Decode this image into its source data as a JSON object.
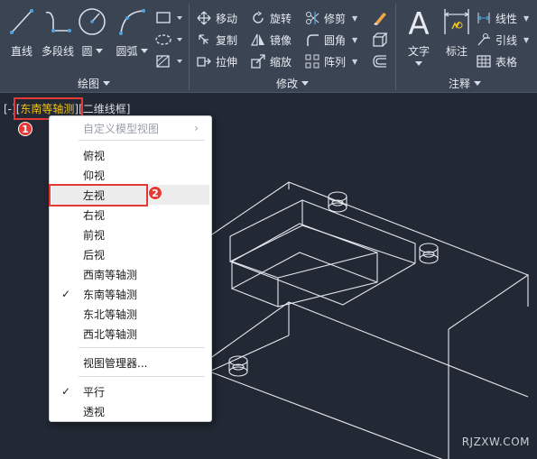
{
  "ribbon": {
    "draw_panel": {
      "title": "绘图",
      "line": "直线",
      "polyline": "多段线",
      "circle": "圆",
      "arc": "圆弧"
    },
    "modify_panel": {
      "title": "修改",
      "move": "移动",
      "rotate": "旋转",
      "trim": "修剪",
      "copy": "复制",
      "mirror": "镜像",
      "fillet": "圆角",
      "stretch": "拉伸",
      "scale": "缩放",
      "array": "阵列"
    },
    "annotate_panel": {
      "title": "注释",
      "text": "文字",
      "dimension": "标注",
      "linear": "线性",
      "leader": "引线",
      "table": "表格"
    }
  },
  "viewport": {
    "prefix": "[-][",
    "view_name": "东南等轴测",
    "suffix": "][二维线框]"
  },
  "context_menu": {
    "custom_views": "自定义模型视图",
    "items": [
      "俯视",
      "仰视",
      "左视",
      "右视",
      "前视",
      "后视",
      "西南等轴测",
      "东南等轴测",
      "东北等轴测",
      "西北等轴测"
    ],
    "view_manager": "视图管理器...",
    "parallel": "平行",
    "perspective": "透视"
  },
  "annotations": {
    "badge1": "1",
    "badge2": "2"
  },
  "watermark": "RJZXW.COM",
  "colors": {
    "ribbon_bg": "#3b4453",
    "canvas_bg": "#222834",
    "highlight": "#f0c419",
    "callout_red": "#e53935",
    "selected_icon_blue": "#4fa3e0"
  },
  "icons": [
    "line-icon",
    "polyline-icon",
    "circle-icon",
    "arc-icon",
    "rectangle-icon",
    "ellipse-icon",
    "hatch-icon",
    "move-icon",
    "rotate-icon",
    "trim-icon",
    "copy-icon",
    "mirror-icon",
    "fillet-icon",
    "stretch-icon",
    "scale-icon",
    "array-icon",
    "eraser-icon",
    "explode-icon",
    "offset-icon",
    "text-icon",
    "dimension-icon",
    "linear-icon",
    "leader-icon",
    "table-icon"
  ]
}
